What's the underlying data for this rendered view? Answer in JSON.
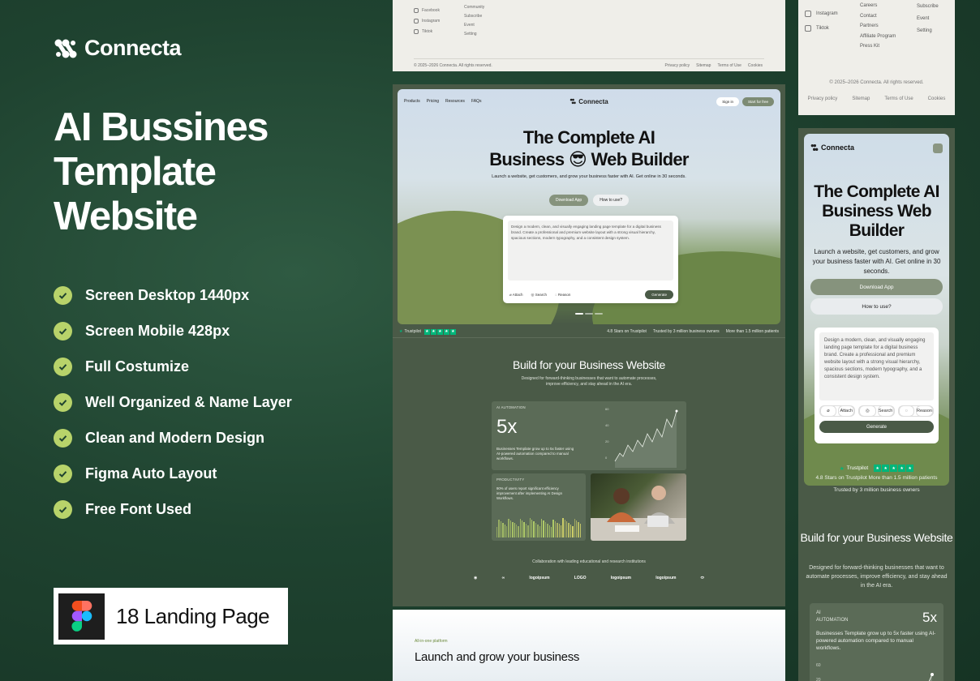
{
  "promo": {
    "brand": "Connecta",
    "headline": "AI Bussines Template Website",
    "features": [
      "Screen Desktop 1440px",
      "Screen Mobile 428px",
      "Full Costumize",
      "Well Organized & Name Layer",
      "Clean and Modern Design",
      "Figma Auto Layout",
      "Free Font Used"
    ],
    "badge": "18 Landing Page"
  },
  "desktop": {
    "footer": {
      "social": [
        "Facebook",
        "Instagram",
        "Tiktok"
      ],
      "links": [
        "Community",
        "Subscribe",
        "Event",
        "Setting"
      ],
      "copyright": "© 2025–2026 Connecta. All rights reserved.",
      "legal": [
        "Privacy policy",
        "Sitemap",
        "Terms of Use",
        "Cookies"
      ]
    },
    "nav": {
      "links": [
        "Products",
        "Pricing",
        "Resources",
        "FAQs"
      ],
      "logo": "Connecta",
      "signin": "Sign in",
      "start": "Start for free"
    },
    "hero": {
      "title_line1": "The Complete AI",
      "title_line2": "Business 😎 Web Builder",
      "subtitle": "Launch a website, get customers, and grow your business faster with AI. Get online in 30 seconds.",
      "download": "Download App",
      "howto": "How to use?",
      "prompt": "Design a modern, clean, and visually engaging landing page template for a digital business brand. Create a professional and premium website layout with a strong visual hierarchy, spacious sections, modern typography, and a consistent design system.",
      "tools": [
        "Attach",
        "Search",
        "Reason"
      ],
      "generate": "Generate"
    },
    "trust": {
      "brand": "Trustpilot",
      "stars": "4.8 Stars on Trustpilot",
      "owners": "Trusted by 3 million business owners",
      "patients": "More than 1.5 million patients"
    },
    "section": {
      "title": "Build for your Business Website",
      "subtitle": "Designed for forward-thinking businesses that want to automate processes, improve efficiency, and stay ahead in the AI era."
    },
    "card_ai": {
      "label": "AI AUTOMATION",
      "value": "5x",
      "desc": "Businesses Template grow up to 5x faster using AI-powered automation compared to manual workflows.",
      "axis": [
        "60",
        "40",
        "20",
        "0"
      ]
    },
    "card_prod": {
      "label": "PRODUCTIVITY",
      "desc": "90% of users report significant efficiency improvement after implementing AI Design Workflows."
    },
    "collab": "Collaboration with leading educational and research institutions",
    "logos": [
      "logoipsum",
      "LOGO",
      "logoipsum",
      "logoipsum"
    ],
    "next": {
      "eyebrow": "All-in-one platform",
      "title": "Launch and grow your business"
    }
  },
  "mobile": {
    "footer": {
      "social": [
        "Instagram",
        "Tiktok"
      ],
      "links": [
        "Careers",
        "Contact",
        "Partners",
        "Affiliate Program",
        "Press Kit"
      ],
      "links2": [
        "Subscribe",
        "Event",
        "Setting"
      ],
      "copyright": "© 2025–2026 Connecta. All rights reserved.",
      "legal": [
        "Privacy policy",
        "Sitemap",
        "Terms of Use",
        "Cookies"
      ]
    },
    "logo": "Connecta",
    "hero": {
      "title": "The Complete AI Business Web Builder",
      "subtitle": "Launch a website, get customers, and grow your business faster with AI. Get online in 30 seconds.",
      "download": "Download App",
      "howto": "How to use?",
      "prompt": "Design a modern, clean, and visually engaging landing page template for a digital business brand. Create a professional and premium website layout with a strong visual hierarchy, spacious sections, modern typography, and a consistent design system.",
      "tools": [
        "Attach",
        "Search",
        "Reason"
      ],
      "generate": "Generate"
    },
    "trust": {
      "brand": "Trustpilot",
      "line1": "4.8 Stars on Trustpilot   More than 1.5 million patients",
      "line2": "Trusted by 3 million business owners"
    },
    "section": {
      "title": "Build for your Business Website",
      "subtitle": "Designed for forward-thinking businesses that want to automate processes, improve efficiency, and stay ahead in the AI era."
    },
    "card": {
      "label": "AI AUTOMATION",
      "value": "5x",
      "desc": "Businesses Template grow up to 5x faster using AI-powered automation compared to manual workflows.",
      "axis": [
        "60",
        "20"
      ]
    }
  },
  "colors": {
    "bg": "#1f4330",
    "accent": "#b8d36a",
    "card": "#5b6b57",
    "trustpilot": "#00b67a"
  }
}
